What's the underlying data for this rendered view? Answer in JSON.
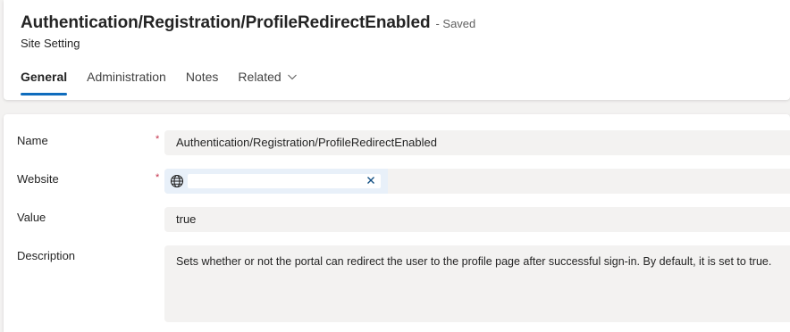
{
  "record": {
    "title": "Authentication/Registration/ProfileRedirectEnabled",
    "status": "- Saved",
    "entity": "Site Setting"
  },
  "tabs": [
    {
      "label": "General",
      "active": true
    },
    {
      "label": "Administration",
      "active": false
    },
    {
      "label": "Notes",
      "active": false
    },
    {
      "label": "Related",
      "active": false
    }
  ],
  "form": {
    "name": {
      "label": "Name",
      "required": "*",
      "value": "Authentication/Registration/ProfileRedirectEnabled"
    },
    "website": {
      "label": "Website",
      "required": "*",
      "value": "",
      "icon": "globe-icon"
    },
    "value": {
      "label": "Value",
      "value": "true"
    },
    "description": {
      "label": "Description",
      "value": "Sets whether or not the portal can redirect the user to the profile page after successful sign-in. By default, it is set to true."
    }
  },
  "colors": {
    "accent": "#0f6cbd",
    "required": "#c4314b",
    "field_bg": "#f3f2f1"
  }
}
